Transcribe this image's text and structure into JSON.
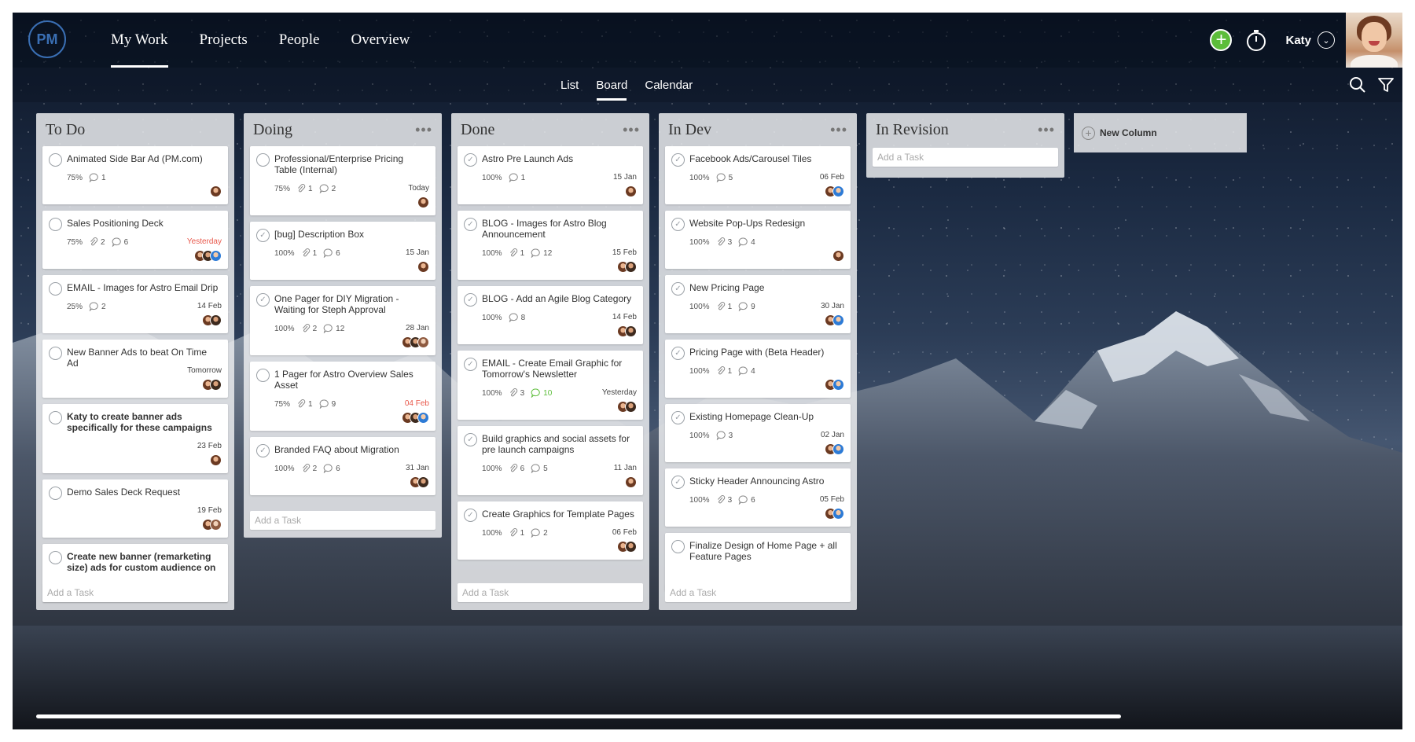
{
  "app": {
    "logo": "PM"
  },
  "nav": {
    "items": [
      "My Work",
      "Projects",
      "People",
      "Overview"
    ],
    "active": "My Work"
  },
  "user": {
    "name": "Katy"
  },
  "subnav": {
    "items": [
      "List",
      "Board",
      "Calendar"
    ],
    "active": "Board"
  },
  "icons": {
    "add": "plus-circle-icon",
    "timer": "stopwatch-icon",
    "user_menu": "chevron-down-icon",
    "search": "search-icon",
    "filter": "filter-icon",
    "attachment": "paperclip-icon",
    "comment": "comment-icon",
    "column_menu": "more-icon"
  },
  "colors": {
    "accent": "#3a6fb4",
    "add_button": "#5cbd3a",
    "overdue": "#e8584b",
    "comment_highlight": "#5cbd3a"
  },
  "board": {
    "add_task_placeholder": "Add a Task",
    "new_column_label": "New Column",
    "columns": [
      {
        "title": "To Do",
        "menu": "",
        "cards": [
          {
            "title": "Animated Side Bar Ad (PM.com)",
            "progress": "75%",
            "attachments": "",
            "comments": "1",
            "due": ""
          },
          {
            "title": "Sales Positioning Deck",
            "progress": "75%",
            "attachments": "2",
            "comments": "6",
            "due": "Yesterday"
          },
          {
            "title": "EMAIL - Images for Astro Email Drip",
            "progress": "25%",
            "attachments": "",
            "comments": "2",
            "due": "14 Feb"
          },
          {
            "title": "New Banner Ads to beat On Time Ad",
            "progress": "",
            "attachments": "",
            "comments": "",
            "due": "Tomorrow"
          },
          {
            "title": "Katy to create banner ads specifically for these campaigns",
            "progress": "",
            "attachments": "",
            "comments": "",
            "due": "23 Feb"
          },
          {
            "title": "Demo Sales Deck Request",
            "progress": "",
            "attachments": "",
            "comments": "",
            "due": "19 Feb"
          },
          {
            "title": "Create new banner (remarketing size) ads for custom audience on",
            "progress": "",
            "attachments": "",
            "comments": "",
            "due": ""
          }
        ]
      },
      {
        "title": "Doing",
        "menu": "•••",
        "cards": [
          {
            "title": "Professional/Enterprise Pricing Table (Internal)",
            "progress": "75%",
            "attachments": "1",
            "comments": "2",
            "due": "Today"
          },
          {
            "title": "[bug] Description Box",
            "progress": "100%",
            "attachments": "1",
            "comments": "6",
            "due": "15 Jan"
          },
          {
            "title": "One Pager for DIY Migration - Waiting for Steph Approval",
            "progress": "100%",
            "attachments": "2",
            "comments": "12",
            "due": "28 Jan"
          },
          {
            "title": "1 Pager for Astro Overview Sales Asset",
            "progress": "75%",
            "attachments": "1",
            "comments": "9",
            "due": "04 Feb"
          },
          {
            "title": "Branded FAQ about Migration",
            "progress": "100%",
            "attachments": "2",
            "comments": "6",
            "due": "31 Jan"
          }
        ]
      },
      {
        "title": "Done",
        "menu": "•••",
        "cards": [
          {
            "title": "Astro Pre Launch Ads",
            "progress": "100%",
            "attachments": "",
            "comments": "1",
            "due": "15 Jan"
          },
          {
            "title": "BLOG - Images for Astro Blog Announcement",
            "progress": "100%",
            "attachments": "1",
            "comments": "12",
            "due": "15 Feb"
          },
          {
            "title": "BLOG - Add an Agile Blog Category",
            "progress": "100%",
            "attachments": "",
            "comments": "8",
            "due": "14 Feb"
          },
          {
            "title": "EMAIL - Create Email Graphic for Tomorrow's Newsletter",
            "progress": "100%",
            "attachments": "3",
            "comments": "10",
            "due": "Yesterday"
          },
          {
            "title": "Build graphics and social assets for pre launch campaigns",
            "progress": "100%",
            "attachments": "6",
            "comments": "5",
            "due": "11 Jan"
          },
          {
            "title": "Create Graphics for Template Pages",
            "progress": "100%",
            "attachments": "1",
            "comments": "2",
            "due": "06 Feb"
          }
        ]
      },
      {
        "title": "In Dev",
        "menu": "•••",
        "cards": [
          {
            "title": "Facebook Ads/Carousel Tiles",
            "progress": "100%",
            "attachments": "",
            "comments": "5",
            "due": "06 Feb"
          },
          {
            "title": "Website Pop-Ups Redesign",
            "progress": "100%",
            "attachments": "3",
            "comments": "4",
            "due": ""
          },
          {
            "title": "New Pricing Page",
            "progress": "100%",
            "attachments": "1",
            "comments": "9",
            "due": "30 Jan"
          },
          {
            "title": "Pricing Page with (Beta Header)",
            "progress": "100%",
            "attachments": "1",
            "comments": "4",
            "due": ""
          },
          {
            "title": "Existing Homepage Clean-Up",
            "progress": "100%",
            "attachments": "",
            "comments": "3",
            "due": "02 Jan"
          },
          {
            "title": "Sticky Header Announcing Astro",
            "progress": "100%",
            "attachments": "3",
            "comments": "6",
            "due": "05 Feb"
          },
          {
            "title": "Finalize Design of Home Page + all Feature Pages",
            "progress": "",
            "attachments": "",
            "comments": "",
            "due": ""
          }
        ]
      },
      {
        "title": "In Revision",
        "menu": "•••",
        "cards": []
      }
    ]
  }
}
